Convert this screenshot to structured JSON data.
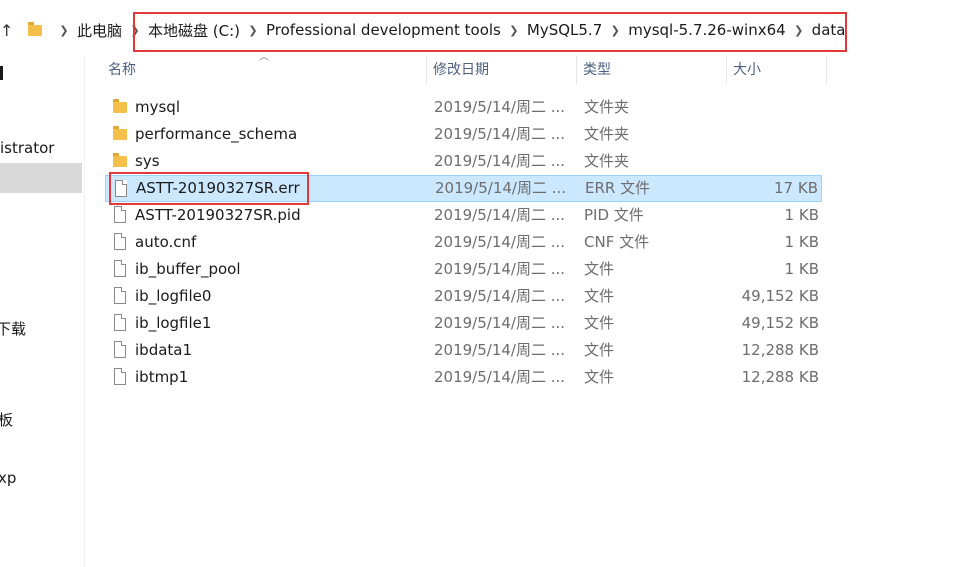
{
  "address_bar": {
    "crumbs": [
      "此电脑",
      "本地磁盘 (C:)",
      "Professional development tools",
      "MySQL5.7",
      "mysql-5.7.26-winx64",
      "data"
    ]
  },
  "nav_pane": {
    "items": [
      "istrator",
      "下载",
      "板",
      "xp"
    ]
  },
  "columns": {
    "name": "名称",
    "date": "修改日期",
    "type": "类型",
    "size": "大小"
  },
  "files": [
    {
      "name": "mysql",
      "date": "2019/5/14/周二 ...",
      "type": "文件夹",
      "size": "",
      "icon": "folder-icon"
    },
    {
      "name": "performance_schema",
      "date": "2019/5/14/周二 ...",
      "type": "文件夹",
      "size": "",
      "icon": "folder-icon"
    },
    {
      "name": "sys",
      "date": "2019/5/14/周二 ...",
      "type": "文件夹",
      "size": "",
      "icon": "folder-icon"
    },
    {
      "name": "ASTT-20190327SR.err",
      "date": "2019/5/14/周二 ...",
      "type": "ERR 文件",
      "size": "17 KB",
      "icon": "file-icon",
      "selected": true
    },
    {
      "name": "ASTT-20190327SR.pid",
      "date": "2019/5/14/周二 ...",
      "type": "PID 文件",
      "size": "1 KB",
      "icon": "file-icon"
    },
    {
      "name": "auto.cnf",
      "date": "2019/5/14/周二 ...",
      "type": "CNF 文件",
      "size": "1 KB",
      "icon": "file-icon"
    },
    {
      "name": "ib_buffer_pool",
      "date": "2019/5/14/周二 ...",
      "type": "文件",
      "size": "1 KB",
      "icon": "file-icon"
    },
    {
      "name": "ib_logfile0",
      "date": "2019/5/14/周二 ...",
      "type": "文件",
      "size": "49,152 KB",
      "icon": "file-icon"
    },
    {
      "name": "ib_logfile1",
      "date": "2019/5/14/周二 ...",
      "type": "文件",
      "size": "49,152 KB",
      "icon": "file-icon"
    },
    {
      "name": "ibdata1",
      "date": "2019/5/14/周二 ...",
      "type": "文件",
      "size": "12,288 KB",
      "icon": "file-icon"
    },
    {
      "name": "ibtmp1",
      "date": "2019/5/14/周二 ...",
      "type": "文件",
      "size": "12,288 KB",
      "icon": "file-icon"
    }
  ],
  "colors": {
    "selected_bg": "#cce8ff",
    "annotation_red": "#e23a3a",
    "folder": "#f4c04a"
  }
}
